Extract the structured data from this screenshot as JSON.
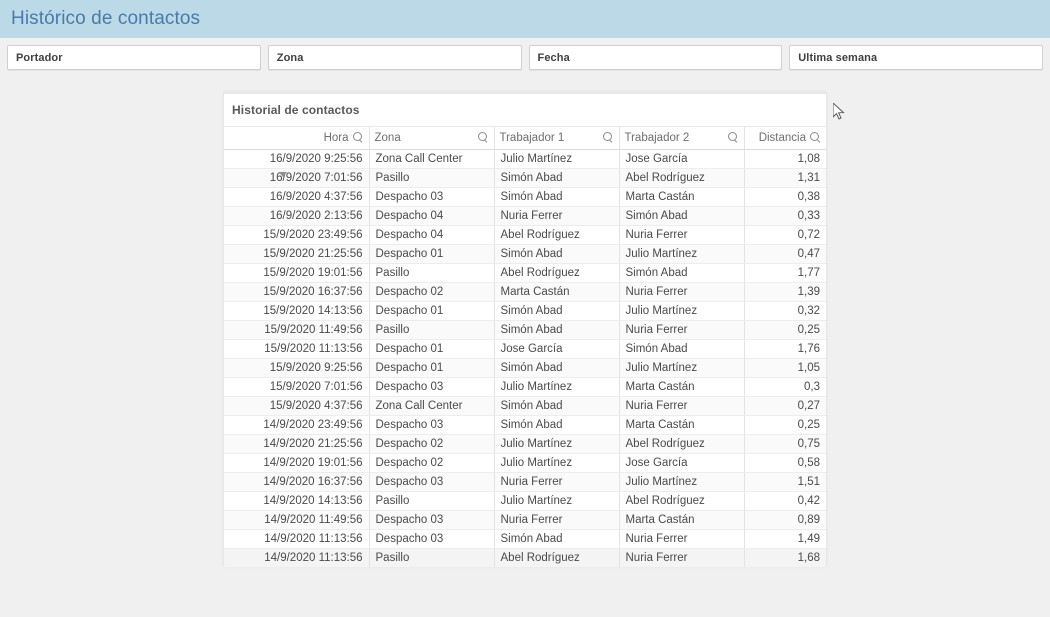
{
  "header": {
    "title": "Histórico de contactos",
    "background": "#bcd9e8",
    "text_color": "#4a7ba8"
  },
  "filters": [
    {
      "label": "Portador"
    },
    {
      "label": "Zona"
    },
    {
      "label": "Fecha"
    },
    {
      "label": "Ultima semana"
    }
  ],
  "panel": {
    "title": "Historial de contactos",
    "sort_column": "Hora",
    "sort_direction": "descending"
  },
  "table": {
    "columns": [
      {
        "label": "Hora",
        "align": "right",
        "icon": "search-icon"
      },
      {
        "label": "Zona",
        "align": "left",
        "icon": "search-icon"
      },
      {
        "label": "Trabajador 1",
        "align": "left",
        "icon": "search-icon"
      },
      {
        "label": "Trabajador 2",
        "align": "left",
        "icon": "search-icon"
      },
      {
        "label": "Distancia",
        "align": "right",
        "icon": "search-icon"
      }
    ],
    "rows": [
      {
        "hora": "16/9/2020 9:25:56",
        "zona": "Zona Call Center",
        "t1": "Julio Martínez",
        "t2": "Jose García",
        "distancia": "1,08"
      },
      {
        "hora": "16/9/2020 7:01:56",
        "zona": "Pasillo",
        "t1": "Simón Abad",
        "t2": "Abel Rodríguez",
        "distancia": "1,31"
      },
      {
        "hora": "16/9/2020 4:37:56",
        "zona": "Despacho 03",
        "t1": "Simón Abad",
        "t2": "Marta Castán",
        "distancia": "0,38"
      },
      {
        "hora": "16/9/2020 2:13:56",
        "zona": "Despacho 04",
        "t1": "Nuria Ferrer",
        "t2": "Simón Abad",
        "distancia": "0,33"
      },
      {
        "hora": "15/9/2020 23:49:56",
        "zona": "Despacho 04",
        "t1": "Abel Rodríguez",
        "t2": "Nuria Ferrer",
        "distancia": "0,72"
      },
      {
        "hora": "15/9/2020 21:25:56",
        "zona": "Despacho 01",
        "t1": "Simón Abad",
        "t2": "Julio Martínez",
        "distancia": "0,47"
      },
      {
        "hora": "15/9/2020 19:01:56",
        "zona": "Pasillo",
        "t1": "Abel Rodríguez",
        "t2": "Simón Abad",
        "distancia": "1,77"
      },
      {
        "hora": "15/9/2020 16:37:56",
        "zona": "Despacho 02",
        "t1": "Marta Castán",
        "t2": "Nuria Ferrer",
        "distancia": "1,39"
      },
      {
        "hora": "15/9/2020 14:13:56",
        "zona": "Despacho 01",
        "t1": "Simón Abad",
        "t2": "Julio Martínez",
        "distancia": "0,32"
      },
      {
        "hora": "15/9/2020 11:49:56",
        "zona": "Pasillo",
        "t1": "Simón Abad",
        "t2": "Nuria Ferrer",
        "distancia": "0,25"
      },
      {
        "hora": "15/9/2020 11:13:56",
        "zona": "Despacho 01",
        "t1": "Jose García",
        "t2": "Simón Abad",
        "distancia": "1,76"
      },
      {
        "hora": "15/9/2020 9:25:56",
        "zona": "Despacho 01",
        "t1": "Simón Abad",
        "t2": "Julio Martínez",
        "distancia": "1,05"
      },
      {
        "hora": "15/9/2020 7:01:56",
        "zona": "Despacho 03",
        "t1": "Julio Martínez",
        "t2": "Marta Castán",
        "distancia": "0,3"
      },
      {
        "hora": "15/9/2020 4:37:56",
        "zona": "Zona Call Center",
        "t1": "Simón Abad",
        "t2": "Nuria Ferrer",
        "distancia": "0,27"
      },
      {
        "hora": "14/9/2020 23:49:56",
        "zona": "Despacho 03",
        "t1": "Simón Abad",
        "t2": "Marta Castán",
        "distancia": "0,25"
      },
      {
        "hora": "14/9/2020 21:25:56",
        "zona": "Despacho 02",
        "t1": "Julio Martínez",
        "t2": "Abel Rodríguez",
        "distancia": "0,75"
      },
      {
        "hora": "14/9/2020 19:01:56",
        "zona": "Despacho 02",
        "t1": "Julio Martínez",
        "t2": "Jose García",
        "distancia": "0,58"
      },
      {
        "hora": "14/9/2020 16:37:56",
        "zona": "Despacho 03",
        "t1": "Nuria Ferrer",
        "t2": "Julio Martínez",
        "distancia": "1,51"
      },
      {
        "hora": "14/9/2020 14:13:56",
        "zona": "Pasillo",
        "t1": "Julio Martínez",
        "t2": "Abel Rodríguez",
        "distancia": "0,42"
      },
      {
        "hora": "14/9/2020 11:49:56",
        "zona": "Despacho 03",
        "t1": "Nuria Ferrer",
        "t2": "Marta Castán",
        "distancia": "0,89"
      },
      {
        "hora": "14/9/2020 11:13:56",
        "zona": "Despacho 03",
        "t1": "Simón Abad",
        "t2": "Nuria Ferrer",
        "distancia": "1,49"
      },
      {
        "hora": "14/9/2020 11:13:56",
        "zona": "Pasillo",
        "t1": "Abel Rodríguez",
        "t2": "Nuria Ferrer",
        "distancia": "1,68"
      }
    ]
  }
}
